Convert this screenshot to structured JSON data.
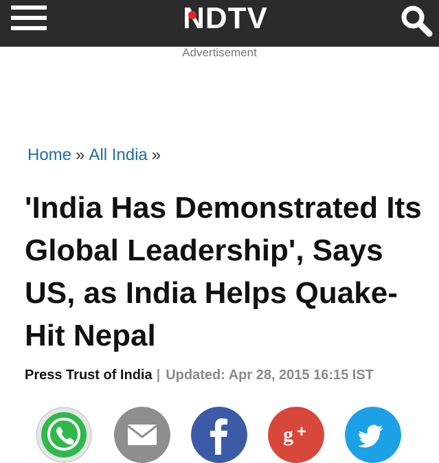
{
  "header": {
    "logo_text": "NDTV",
    "menu_icon": "hamburger-icon",
    "search_icon": "search-icon",
    "background_color": "#2b2b2b",
    "logo_dot_color": "#e8232a"
  },
  "ad": {
    "label": "Advertisement"
  },
  "breadcrumb": {
    "items": [
      {
        "label": "Home"
      },
      {
        "label": "All India"
      }
    ],
    "separator": "»",
    "link_color": "#1d6fa8"
  },
  "article": {
    "title": "'India Has Demonstrated Its Global Leadership', Says US, as India Helps Quake-Hit Nepal",
    "author": "Press Trust of India",
    "byline_separator": "|",
    "updated": "Updated: Apr 28, 2015 16:15 IST"
  },
  "share": [
    {
      "name": "whatsapp",
      "icon": "whatsapp-icon",
      "color": "#2fb84b"
    },
    {
      "name": "email",
      "icon": "email-icon",
      "color": "#8e8e8e"
    },
    {
      "name": "facebook",
      "icon": "facebook-icon",
      "color": "#3b5ba6"
    },
    {
      "name": "google-plus",
      "icon": "google-plus-icon",
      "color": "#d7473a"
    },
    {
      "name": "twitter",
      "icon": "twitter-icon",
      "color": "#1da1e6"
    }
  ]
}
